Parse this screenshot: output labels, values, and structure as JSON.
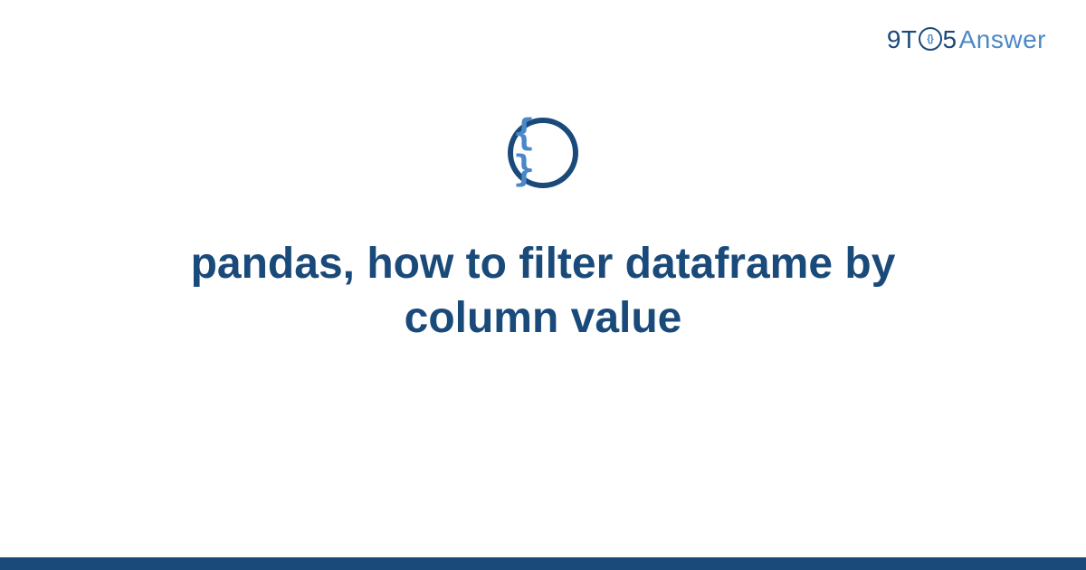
{
  "brand": {
    "part1": "9T",
    "circle_inner": "{}",
    "part2": "5",
    "part3": "Answer"
  },
  "badge": {
    "symbol": "{ }"
  },
  "title": "pandas, how to filter dataframe by column value",
  "colors": {
    "dark_blue": "#1a4a7a",
    "light_blue": "#4a88c7"
  }
}
